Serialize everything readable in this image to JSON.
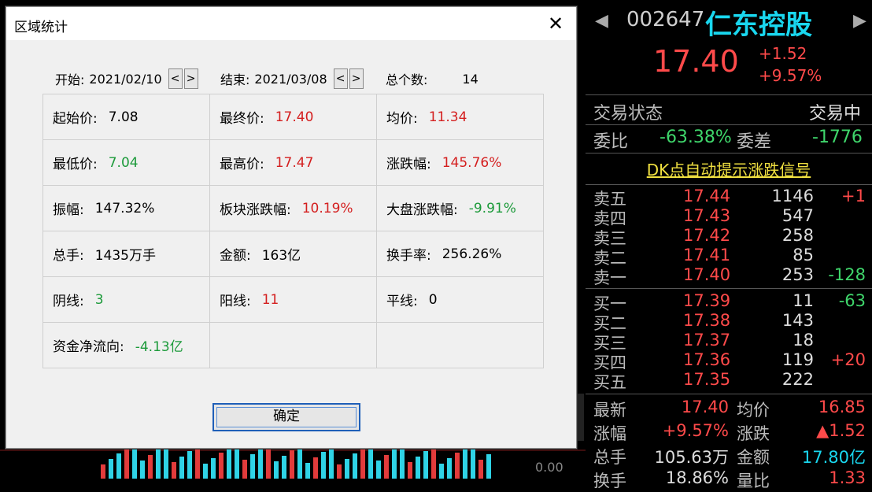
{
  "dialog": {
    "title": "区域统计",
    "start_label": "开始:",
    "start_date": "2021/02/10",
    "end_label": "结束:",
    "end_date": "2021/03/08",
    "count_label": "总个数:",
    "count_value": "14",
    "prev_glyph": "<",
    "next_glyph": ">",
    "close_glyph": "✕",
    "stats": [
      [
        {
          "label": "起始价:",
          "value": "7.08",
          "color": "black"
        },
        {
          "label": "最终价:",
          "value": "17.40",
          "color": "red"
        },
        {
          "label": "均价:",
          "value": "11.34",
          "color": "red"
        }
      ],
      [
        {
          "label": "最低价:",
          "value": "7.04",
          "color": "green"
        },
        {
          "label": "最高价:",
          "value": "17.47",
          "color": "red"
        },
        {
          "label": "涨跌幅:",
          "value": "145.76%",
          "color": "red"
        }
      ],
      [
        {
          "label": "振幅:",
          "value": "147.32%",
          "color": "black"
        },
        {
          "label": "板块涨跌幅:",
          "value": "10.19%",
          "color": "red"
        },
        {
          "label": "大盘涨跌幅:",
          "value": "-9.91%",
          "color": "green"
        }
      ],
      [
        {
          "label": "总手:",
          "value": "1435万手",
          "color": "black"
        },
        {
          "label": "金额:",
          "value": "163亿",
          "color": "black"
        },
        {
          "label": "换手率:",
          "value": "256.26%",
          "color": "black"
        }
      ],
      [
        {
          "label": "阴线:",
          "value": "3",
          "color": "green"
        },
        {
          "label": "阳线:",
          "value": "11",
          "color": "red"
        },
        {
          "label": "平线:",
          "value": "0",
          "color": "black"
        }
      ],
      [
        {
          "label": "资金净流向:",
          "value": "-4.13亿",
          "color": "green"
        },
        {
          "label": "",
          "value": "",
          "color": "black"
        },
        {
          "label": "",
          "value": "",
          "color": "black"
        }
      ]
    ],
    "ok_label": "确定"
  },
  "background": {
    "axis_value": "0.00"
  },
  "panel": {
    "code": "002647",
    "name": "仁东控股",
    "price": "17.40",
    "change": "+1.52",
    "change_pct": "+9.57%",
    "status_label": "交易状态",
    "status_value": "交易中",
    "webi_label": "委比",
    "webi_value": "-63.38%",
    "weicha_label": "委差",
    "weicha_value": "-1776",
    "signal": "DK点自动提示涨跌信号",
    "sell": [
      {
        "label": "卖五",
        "price": "17.44",
        "vol": "1146",
        "delta": "+1"
      },
      {
        "label": "卖四",
        "price": "17.43",
        "vol": "547",
        "delta": ""
      },
      {
        "label": "卖三",
        "price": "17.42",
        "vol": "258",
        "delta": ""
      },
      {
        "label": "卖二",
        "price": "17.41",
        "vol": "85",
        "delta": ""
      },
      {
        "label": "卖一",
        "price": "17.40",
        "vol": "253",
        "delta": "-128"
      }
    ],
    "buy": [
      {
        "label": "买一",
        "price": "17.39",
        "vol": "11",
        "delta": "-63"
      },
      {
        "label": "买二",
        "price": "17.38",
        "vol": "143",
        "delta": ""
      },
      {
        "label": "买三",
        "price": "17.37",
        "vol": "18",
        "delta": ""
      },
      {
        "label": "买四",
        "price": "17.36",
        "vol": "119",
        "delta": "+20"
      },
      {
        "label": "买五",
        "price": "17.35",
        "vol": "222",
        "delta": ""
      }
    ],
    "stats": [
      {
        "l1": "最新",
        "v1": "17.40",
        "c1": "#ff4a4a",
        "l2": "均价",
        "v2": "16.85",
        "c2": "#ff4a4a"
      },
      {
        "l1": "涨幅",
        "v1": "+9.57%",
        "c1": "#ff4a4a",
        "l2": "涨跌",
        "v2": "▲1.52",
        "c2": "#ff4a4a"
      },
      {
        "l1": "总手",
        "v1": "105.63万",
        "c1": "#dddddd",
        "l2": "金额",
        "v2": "17.80亿",
        "c2": "#19d7ef"
      },
      {
        "l1": "换手",
        "v1": "18.86%",
        "c1": "#dddddd",
        "l2": "量比",
        "v2": "1.33",
        "c2": "#ff4a4a"
      }
    ]
  }
}
